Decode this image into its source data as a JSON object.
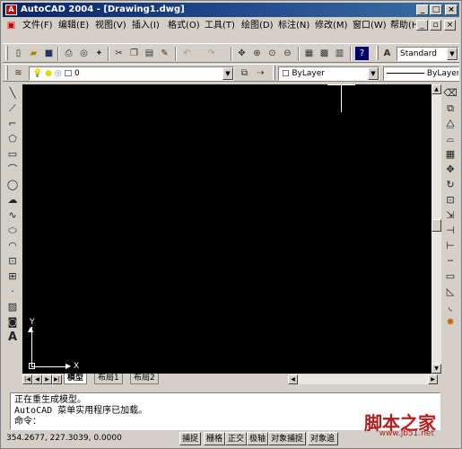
{
  "window": {
    "title": "AutoCAD 2004 - [Drawing1.dwg]",
    "min": "_",
    "max": "□",
    "close": "×"
  },
  "menu": [
    "文件(F)",
    "编辑(E)",
    "视图(V)",
    "插入(I)",
    "格式(O)",
    "工具(T)",
    "绘图(D)",
    "标注(N)",
    "修改(M)",
    "窗口(W)",
    "帮助(H)"
  ],
  "mdi": {
    "min": "_",
    "restore": "▫",
    "close": "×"
  },
  "toolbar": {
    "text_style": "Standard",
    "layer": "0",
    "color": "ByLayer",
    "linetype": "ByLayer"
  },
  "drawing": {
    "ucs_x": "X",
    "ucs_y": "Y",
    "tabs": [
      "模型",
      "布局1",
      "布局2"
    ],
    "active_tab": "模型"
  },
  "command": {
    "lines": [
      "正在重生成模型。",
      "AutoCAD 菜单实用程序已加载。"
    ],
    "prompt": "命令："
  },
  "status": {
    "coords": "354.2677,  227.3039,  0.0000",
    "buttons": [
      "捕捉",
      "栅格",
      "正交",
      "极轴",
      "对象捕捉",
      "对象追"
    ]
  },
  "watermark": {
    "text": "脚本之家",
    "url": "www.jb51.net"
  }
}
